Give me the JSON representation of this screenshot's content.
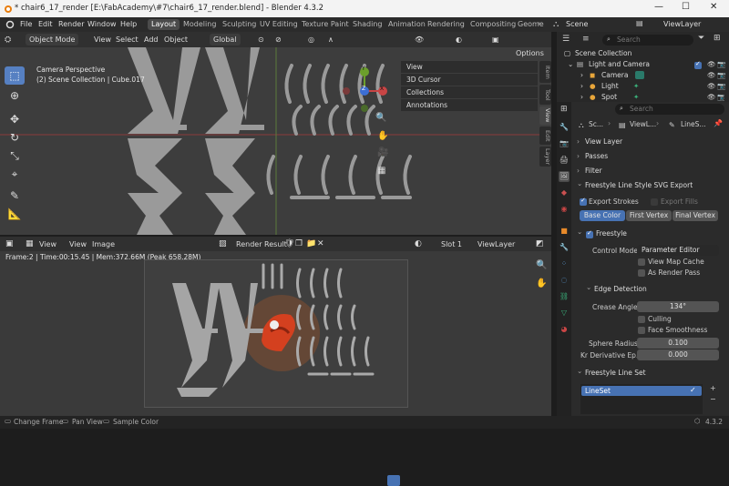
{
  "window": {
    "title": "* chair6_17_render [E:\\FabAcademy\\#7\\chair6_17_render.blend] - Blender 4.3.2",
    "minimize": "—",
    "maximize": "☐",
    "close": "✕"
  },
  "menu": {
    "file": "File",
    "edit": "Edit",
    "render": "Render",
    "window": "Window",
    "help": "Help"
  },
  "workspaces": [
    "Layout",
    "Modeling",
    "Sculpting",
    "UV Editing",
    "Texture Paint",
    "Shading",
    "Animation",
    "Rendering",
    "Compositing",
    "Geome"
  ],
  "scene": {
    "name": "Scene",
    "view_layer": "ViewLayer"
  },
  "viewport3d": {
    "mode": "Object Mode",
    "view": "View",
    "select": "Select",
    "add": "Add",
    "object": "Object",
    "orientation": "Global",
    "options": "Options",
    "overlay_line1": "Camera Perspective",
    "overlay_line2": "(2) Scene Collection | Cube.017"
  },
  "npanel": {
    "items": [
      "View",
      "3D Cursor",
      "Collections",
      "Annotations"
    ],
    "tabs": [
      "Item",
      "Tool",
      "View",
      "Edit",
      "Layer"
    ]
  },
  "gizmo": {
    "y": "Y",
    "z": "Z",
    "x": "X"
  },
  "image_editor": {
    "view": "View",
    "view2": "View",
    "image": "Image",
    "image_name": "Render Result",
    "slot": "Slot 1",
    "layer": "ViewLayer",
    "info": "Frame:2 | Time:00:15.45 | Mem:372.66M (Peak 658.28M)"
  },
  "outliner": {
    "search_placeholder": "Search",
    "rows": [
      "Scene Collection",
      "Light and Camera",
      "Camera",
      "Light",
      "Spot"
    ]
  },
  "properties": {
    "search_placeholder": "Search",
    "breadcrumb": [
      "Sc...",
      "ViewL...",
      "LineS..."
    ],
    "sections": {
      "view_layer": "View Layer",
      "passes": "Passes",
      "filter": "Filter",
      "svg_export": "Freestyle Line Style SVG Export",
      "freestyle": "Freestyle",
      "edge_detection": "Edge Detection",
      "line_set": "Freestyle Line Set"
    },
    "export_strokes": "Export Strokes",
    "export_fills": "Export Fills",
    "color_tabs": [
      "Base Color",
      "First Vertex",
      "Final Vertex"
    ],
    "control_mode_label": "Control Mode",
    "control_mode_value": "Parameter Editor",
    "view_map_cache": "View Map Cache",
    "as_render_pass": "As Render Pass",
    "crease_angle_label": "Crease Angle",
    "crease_angle_value": "134°",
    "culling": "Culling",
    "face_smoothness": "Face Smoothness",
    "sphere_radius_label": "Sphere Radius",
    "sphere_radius_value": "0.100",
    "kr_label": "Kr Derivative Ep...",
    "kr_value": "0.000",
    "lineset_item": "LineSet"
  },
  "status": {
    "change_frame": "Change Frame",
    "pan_view": "Pan View",
    "sample_color": "Sample Color",
    "version": "4.3.2"
  },
  "colors": {
    "accent": "#4772b3",
    "active_tab": "#5680c2",
    "bg": "#1d1d1d"
  }
}
